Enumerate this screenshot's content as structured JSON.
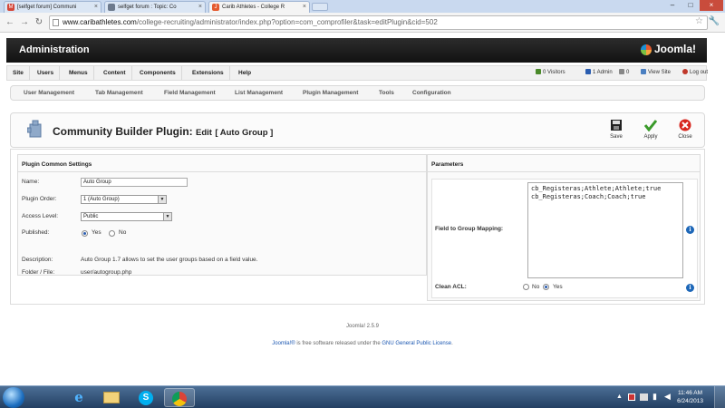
{
  "browser": {
    "tabs": [
      {
        "label": "[selfget forum] Communi",
        "icon": "gmail-icon",
        "color": "#d44638"
      },
      {
        "label": "selfget forum : Topic: Co",
        "icon": "page-icon",
        "color": "#6d7a8d"
      },
      {
        "label": "Carib Athletes - College R",
        "icon": "joomla-icon",
        "color": "#e45a2f"
      }
    ],
    "url_host": "www.caribathletes.com",
    "url_path": "/college-recruiting/administrator/index.php?option=com_comprofiler&task=editPlugin&cid=502"
  },
  "header": {
    "title": "Administration",
    "logo_text": "Joomla!"
  },
  "menu": {
    "items": [
      "Site",
      "Users",
      "Menus",
      "Content",
      "Components",
      "Extensions",
      "Help"
    ],
    "status": [
      {
        "label": "0 Visitors",
        "color": "#4a8a2a"
      },
      {
        "label": "1 Admin",
        "color": "#2a5db0"
      },
      {
        "label": "0",
        "color": "#888888"
      },
      {
        "label": "View Site",
        "color": "#4a7fc1"
      },
      {
        "label": "Log out",
        "color": "#c0392b"
      }
    ]
  },
  "submenu": [
    "User Management",
    "Tab Management",
    "Field Management",
    "List Management",
    "Plugin Management",
    "Tools",
    "Configuration"
  ],
  "toolbar": {
    "title_main": "Community Builder Plugin:",
    "title_edit": "Edit",
    "title_item": "[ Auto Group ]",
    "save": "Save",
    "apply": "Apply",
    "close": "Close"
  },
  "left_panel": {
    "legend": "Plugin Common Settings",
    "name_label": "Name:",
    "name_value": "Auto Group",
    "order_label": "Plugin Order:",
    "order_value": "1 (Auto Group)",
    "access_label": "Access Level:",
    "access_value": "Public",
    "published_label": "Published:",
    "yes": "Yes",
    "no": "No",
    "published_value": "Yes",
    "description_label": "Description:",
    "description_value": "Auto Group 1.7 allows to set the user groups based on a field value.",
    "folder_label": "Folder / File:",
    "folder_value": "user/autogroup.php"
  },
  "right_panel": {
    "legend": "Parameters",
    "mapping_label": "Field to Group Mapping:",
    "mapping_value": "cb_Registeras;Athlete;Athlete;true\ncb_Registeras;Coach;Coach;true",
    "acl_label": "Clean ACL:",
    "acl_no": "No",
    "acl_yes": "Yes",
    "acl_value": "Yes"
  },
  "footer": {
    "version": "Joomla! 2.5.9",
    "license_link1": "Joomla!®",
    "license_mid": " is free software released under the ",
    "license_link2": "GNU General Public License",
    "license_end": "."
  },
  "taskbar": {
    "time": "11:46 AM",
    "date": "6/24/2013"
  }
}
